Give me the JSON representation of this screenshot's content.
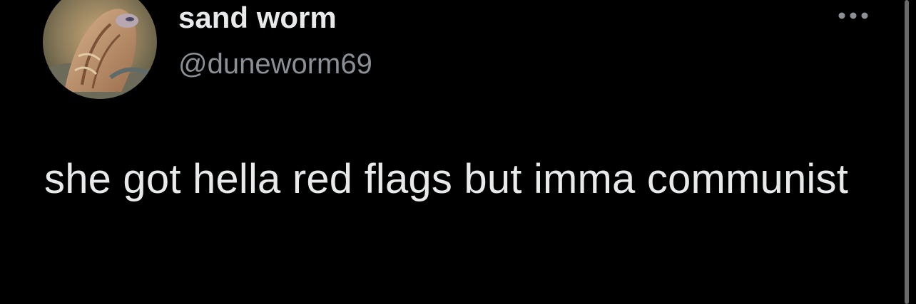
{
  "tweet": {
    "author": {
      "display_name": "sand worm",
      "handle": "@duneworm69",
      "avatar_icon": "profile-avatar-image"
    },
    "text": "she got hella red flags but imma communist",
    "more_icon": "more-horizontal-icon"
  },
  "colors": {
    "background": "#000000",
    "primary_text": "#e7e9ea",
    "secondary_text": "#8b9096"
  }
}
